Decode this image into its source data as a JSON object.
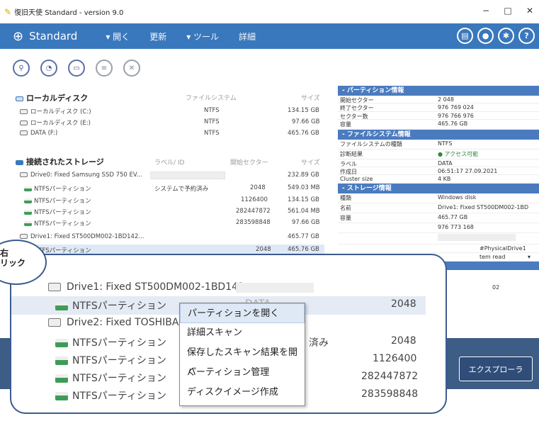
{
  "window": {
    "title": "復旧天使 Standard - version 9.0",
    "minimize": "−",
    "maximize": "□",
    "close": "✕"
  },
  "toolbar": {
    "app_name": "Standard",
    "menu": [
      "▾ 開く",
      "更新",
      "▾ ツール",
      "詳細"
    ]
  },
  "local": {
    "title": "ローカルディスク",
    "col_fs": "ファイルシステム",
    "col_size": "サイズ",
    "rows": [
      {
        "name": "ローカルディスク (C:)",
        "fs": "NTFS",
        "size": "134.15 GB"
      },
      {
        "name": "ローカルディスク (E:)",
        "fs": "NTFS",
        "size": "97.66 GB"
      },
      {
        "name": "DATA (F:)",
        "fs": "NTFS",
        "size": "465.76 GB"
      }
    ]
  },
  "storage": {
    "title": "接続されたストレージ",
    "col_label": "ラベル/ ID",
    "col_start": "開始セクター",
    "col_size": "サイズ",
    "rows": [
      {
        "name": "Drive0: Fixed Samsung SSD 750 EV...",
        "label": "",
        "start": "",
        "size": "232.89 GB",
        "drive": true
      },
      {
        "name": "NTFSパーティション",
        "label": "システムで予約済み",
        "start": "2048",
        "size": "549.03 MB",
        "drive": false
      },
      {
        "name": "NTFSパーティション",
        "label": "",
        "start": "1126400",
        "size": "134.15 GB",
        "drive": false
      },
      {
        "name": "NTFSパーティション",
        "label": "",
        "start": "282447872",
        "size": "561.04 MB",
        "drive": false
      },
      {
        "name": "NTFSパーティション",
        "label": "",
        "start": "283598848",
        "size": "97.66 GB",
        "drive": false
      },
      {
        "name": "Drive1: Fixed ST500DM002-1BD142...",
        "label": "",
        "start": "",
        "size": "465.77 GB",
        "drive": true
      },
      {
        "name": "NTFSパーティション",
        "label": "",
        "start": "2048",
        "size": "465.76 GB",
        "drive": false
      }
    ]
  },
  "panel": {
    "partition_header": "- パーティション情報",
    "partition": [
      [
        "開始セクター",
        "2 048"
      ],
      [
        "終了セクター",
        "976 769 024"
      ],
      [
        "セクター数",
        "976 766 976"
      ],
      [
        "容量",
        "465.76 GB"
      ]
    ],
    "fs_header": "- ファイルシステム情報",
    "fs": [
      [
        "ファイルシステムの種類",
        "NTFS"
      ],
      [
        "診断結果",
        "● アクセス可能"
      ],
      [
        "ラベル",
        "DATA"
      ],
      [
        "作成日",
        "06:51:17 27.09.2021"
      ],
      [
        "Cluster size",
        "4 KB"
      ]
    ],
    "storage_header": "- ストレージ情報",
    "storage": [
      [
        "種類",
        "Windows disk"
      ],
      [
        "名前",
        "Drive1: Fixed ST500DM002-1BD"
      ],
      [
        "容量",
        "465.77 GB"
      ],
      [
        "",
        "976 773 168"
      ]
    ],
    "extra": [
      "#PhysicalDrive1",
      "tem read"
    ]
  },
  "explorer_button": "エクスプローラ",
  "callout": {
    "line1": "右",
    "line2": "リック"
  },
  "zoom": {
    "rows": [
      {
        "name": "Drive1: Fixed ST500DM002-1BD142...",
        "right": "",
        "drive": true
      },
      {
        "name": "NTFSパーティション",
        "right": "2048",
        "drive": false
      },
      {
        "name": "Drive2: Fixed TOSHIBA M",
        "right": "",
        "drive": true
      },
      {
        "name": "NTFSパーティション",
        "right": "2048",
        "drive": false
      },
      {
        "name": "NTFSパーティション",
        "right": "1126400",
        "drive": false
      },
      {
        "name": "NTFSパーティション",
        "right": "282447872",
        "drive": false
      },
      {
        "name": "NTFSパーティション",
        "right": "283598848",
        "drive": false
      }
    ],
    "label_fragment": "DATA",
    "label_fragment2": "済み"
  },
  "context_menu": [
    "パーティションを開く",
    "詳細スキャン",
    "保存したスキャン結果を開く",
    "パーティション管理",
    "ディスクイメージ作成"
  ]
}
